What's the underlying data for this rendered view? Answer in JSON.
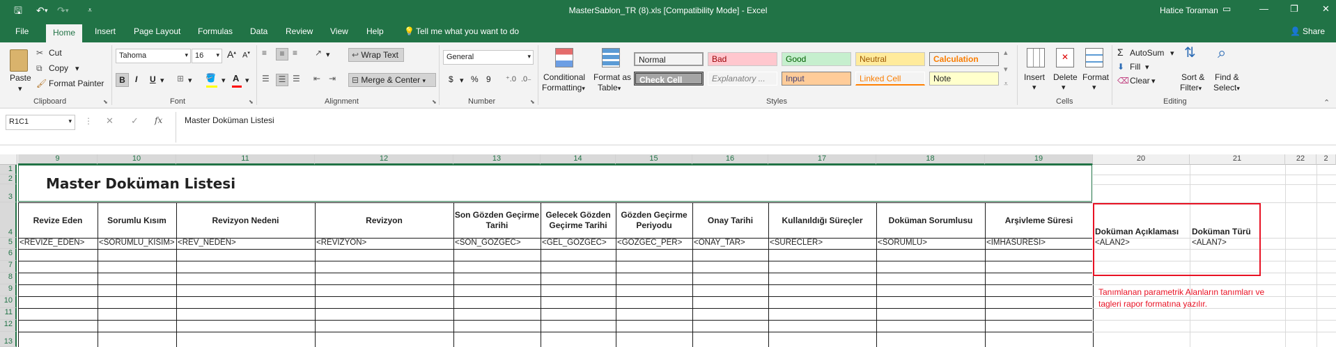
{
  "titlebar": {
    "title": "MasterSablon_TR (8).xls  [Compatibility Mode]  -  Excel",
    "user": "Hatice Toraman",
    "qa_save": "🖫",
    "qa_undo": "↶",
    "qa_redo": "↷",
    "qa_custom": "⩡"
  },
  "tabs": [
    "File",
    "Home",
    "Insert",
    "Page Layout",
    "Formulas",
    "Data",
    "Review",
    "View",
    "Help"
  ],
  "tell_me": "Tell me what you want to do",
  "share": "Share",
  "ribbon": {
    "clipboard": {
      "paste": "Paste",
      "cut": "Cut",
      "copy": "Copy",
      "format_painter": "Format Painter",
      "label": "Clipboard"
    },
    "font": {
      "name": "Tahoma",
      "size": "16",
      "bold": "B",
      "italic": "I",
      "underline": "U",
      "grow": "A",
      "shrink": "A",
      "label": "Font"
    },
    "alignment": {
      "wrap_text": "Wrap Text",
      "merge_center": "Merge & Center",
      "label": "Alignment"
    },
    "number": {
      "format": "General",
      "currency": "$",
      "percent": "%",
      "comma": "9",
      "label": "Number"
    },
    "styles": {
      "conditional_1": "Conditional",
      "conditional_2": "Formatting",
      "format_table_1": "Format as",
      "format_table_2": "Table",
      "cells": [
        {
          "label": "Normal",
          "bg": "#ffffff",
          "color": "#000000"
        },
        {
          "label": "Bad",
          "bg": "#ffc7ce",
          "color": "#9c0006"
        },
        {
          "label": "Good",
          "bg": "#c6efce",
          "color": "#006100"
        },
        {
          "label": "Neutral",
          "bg": "#ffeb9c",
          "color": "#9c5700"
        },
        {
          "label": "Calculation",
          "bg": "#f2f2f2",
          "color": "#fa7d00"
        },
        {
          "label": "Check Cell",
          "bg": "#a5a5a5",
          "color": "#ffffff"
        },
        {
          "label": "Explanatory ...",
          "bg": "#ffffff",
          "color": "#7f7f7f"
        },
        {
          "label": "Input",
          "bg": "#ffcc99",
          "color": "#3f3f76"
        },
        {
          "label": "Linked Cell",
          "bg": "#ffffff",
          "color": "#fa7d00"
        },
        {
          "label": "Note",
          "bg": "#ffffcc",
          "color": "#000000"
        }
      ],
      "label": "Styles"
    },
    "cells": {
      "insert": "Insert",
      "delete": "Delete",
      "format": "Format",
      "label": "Cells"
    },
    "editing": {
      "autosum": "AutoSum",
      "fill": "Fill",
      "clear": "Clear",
      "sort_1": "Sort &",
      "sort_2": "Filter",
      "find_1": "Find &",
      "find_2": "Select",
      "label": "Editing"
    }
  },
  "formula_bar": {
    "name_box": "R1C1",
    "fx": "fx",
    "content": "Master Doküman Listesi"
  },
  "columns": [
    {
      "label": "9",
      "sel": true
    },
    {
      "label": "10",
      "sel": true
    },
    {
      "label": "11",
      "sel": true
    },
    {
      "label": "12",
      "sel": true
    },
    {
      "label": "13",
      "sel": true
    },
    {
      "label": "14",
      "sel": true
    },
    {
      "label": "15",
      "sel": true
    },
    {
      "label": "16",
      "sel": true
    },
    {
      "label": "17",
      "sel": true
    },
    {
      "label": "18",
      "sel": true
    },
    {
      "label": "19",
      "sel": true
    },
    {
      "label": "20",
      "sel": false
    },
    {
      "label": "21",
      "sel": false
    },
    {
      "label": "22",
      "sel": false
    },
    {
      "label": "2",
      "sel": false
    }
  ],
  "rows": [
    "1",
    "2",
    "3",
    "4",
    "5",
    "6",
    "7",
    "8",
    "9",
    "10",
    "11",
    "12",
    "13"
  ],
  "sheet": {
    "title": "Master Doküman Listesi",
    "headers": [
      "Revize Eden",
      "Sorumlu Kısım",
      "Revizyon Nedeni",
      "Revizyon",
      "Son Gözden Geçirme Tarihi",
      "Gelecek Gözden Geçirme Tarihi",
      "Gözden Geçirme Periyodu",
      "Onay Tarihi",
      "Kullanıldığı Süreçler",
      "Doküman Sorumlusu",
      "Arşivleme Süresi"
    ],
    "tags": [
      "<REVIZE_EDEN>",
      "<SORUMLU_KISIM>",
      "<REV_NEDEN>",
      "<REVIZYON>",
      "<SON_GOZGEC>",
      "<GEL_GOZGEC>",
      "<GOZGEC_PER>",
      "<ONAY_TAR>",
      "<SURECLER>",
      "<SORUMLU>",
      "<IMHASURESI>"
    ],
    "extra_headers": [
      "Doküman Açıklaması",
      "Doküman Türü"
    ],
    "extra_tags": [
      "<ALAN2>",
      "<ALAN7>"
    ],
    "note": "Tanımlanan parametrik Alanların tanımları ve tagleri rapor formatına yazılır."
  },
  "colors": {
    "excel_green": "#217346",
    "highlight_red": "#e81123"
  }
}
